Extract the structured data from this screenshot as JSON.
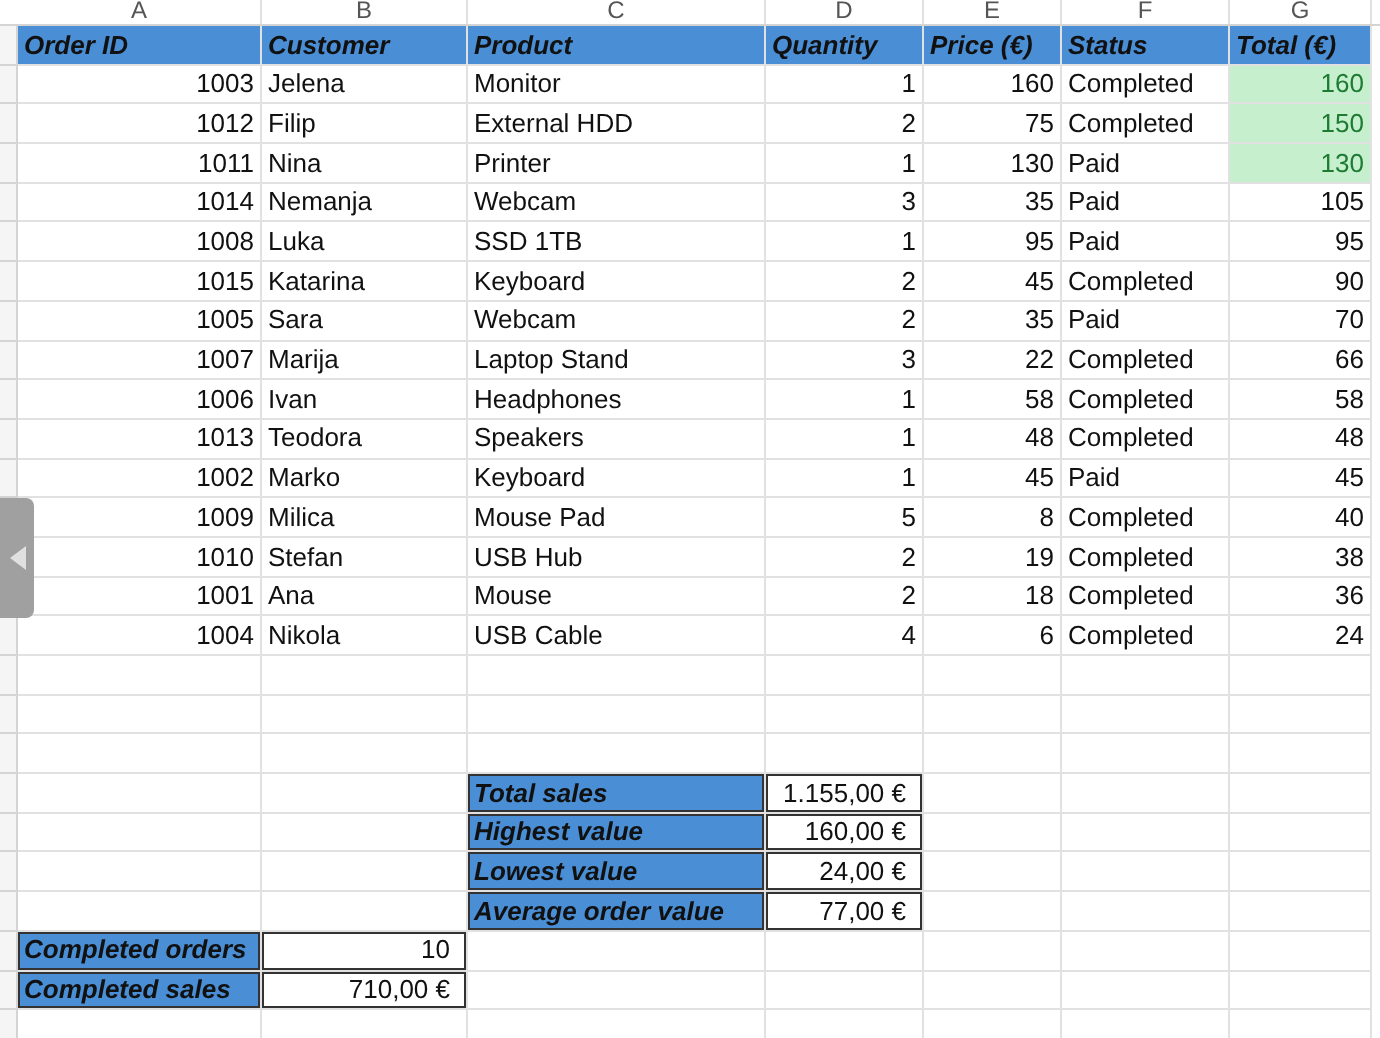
{
  "column_headers": [
    "A",
    "B",
    "C",
    "D",
    "E",
    "F",
    "G"
  ],
  "table": {
    "columns": [
      "Order ID",
      "Customer",
      "Product",
      "Quantity",
      "Price (€)",
      "Status",
      "Total (€)"
    ],
    "rows": [
      {
        "order_id": "1003",
        "customer": "Jelena",
        "product": "Monitor",
        "quantity": "1",
        "price": "160",
        "status": "Completed",
        "total": "160",
        "highlighted": true
      },
      {
        "order_id": "1012",
        "customer": "Filip",
        "product": "External HDD",
        "quantity": "2",
        "price": "75",
        "status": "Completed",
        "total": "150",
        "highlighted": true
      },
      {
        "order_id": "1011",
        "customer": "Nina",
        "product": "Printer",
        "quantity": "1",
        "price": "130",
        "status": "Paid",
        "total": "130",
        "highlighted": true
      },
      {
        "order_id": "1014",
        "customer": "Nemanja",
        "product": "Webcam",
        "quantity": "3",
        "price": "35",
        "status": "Paid",
        "total": "105",
        "highlighted": false
      },
      {
        "order_id": "1008",
        "customer": "Luka",
        "product": "SSD 1TB",
        "quantity": "1",
        "price": "95",
        "status": "Paid",
        "total": "95",
        "highlighted": false
      },
      {
        "order_id": "1015",
        "customer": "Katarina",
        "product": "Keyboard",
        "quantity": "2",
        "price": "45",
        "status": "Completed",
        "total": "90",
        "highlighted": false
      },
      {
        "order_id": "1005",
        "customer": "Sara",
        "product": "Webcam",
        "quantity": "2",
        "price": "35",
        "status": "Paid",
        "total": "70",
        "highlighted": false
      },
      {
        "order_id": "1007",
        "customer": "Marija",
        "product": "Laptop Stand",
        "quantity": "3",
        "price": "22",
        "status": "Completed",
        "total": "66",
        "highlighted": false
      },
      {
        "order_id": "1006",
        "customer": "Ivan",
        "product": "Headphones",
        "quantity": "1",
        "price": "58",
        "status": "Completed",
        "total": "58",
        "highlighted": false
      },
      {
        "order_id": "1013",
        "customer": "Teodora",
        "product": "Speakers",
        "quantity": "1",
        "price": "48",
        "status": "Completed",
        "total": "48",
        "highlighted": false
      },
      {
        "order_id": "1002",
        "customer": "Marko",
        "product": "Keyboard",
        "quantity": "1",
        "price": "45",
        "status": "Paid",
        "total": "45",
        "highlighted": false
      },
      {
        "order_id": "1009",
        "customer": "Milica",
        "product": "Mouse Pad",
        "quantity": "5",
        "price": "8",
        "status": "Completed",
        "total": "40",
        "highlighted": false
      },
      {
        "order_id": "1010",
        "customer": "Stefan",
        "product": "USB Hub",
        "quantity": "2",
        "price": "19",
        "status": "Completed",
        "total": "38",
        "highlighted": false
      },
      {
        "order_id": "1001",
        "customer": "Ana",
        "product": "Mouse",
        "quantity": "2",
        "price": "18",
        "status": "Completed",
        "total": "36",
        "highlighted": false
      },
      {
        "order_id": "1004",
        "customer": "Nikola",
        "product": "USB Cable",
        "quantity": "4",
        "price": "6",
        "status": "Completed",
        "total": "24",
        "highlighted": false
      }
    ]
  },
  "summary": [
    {
      "label": "Total sales",
      "value": "1.155,00 €"
    },
    {
      "label": "Highest value",
      "value": "160,00 €"
    },
    {
      "label": "Lowest value",
      "value": "24,00 €"
    },
    {
      "label": "Average order value",
      "value": "77,00 €"
    }
  ],
  "completed_summary": [
    {
      "label": "Completed orders",
      "value": "10"
    },
    {
      "label": "Completed sales",
      "value": "710,00 €"
    }
  ]
}
